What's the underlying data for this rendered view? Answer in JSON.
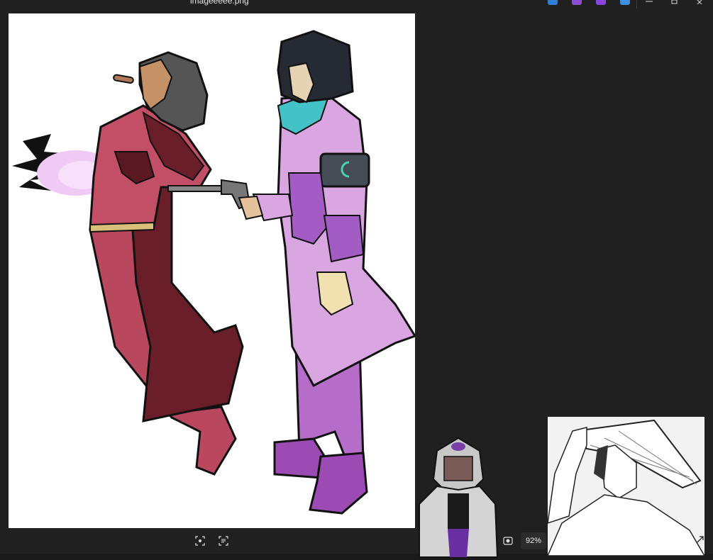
{
  "window": {
    "title": "imageeeee.png",
    "controls": {
      "minimize_icon": "minimize-icon",
      "maximize_icon": "restore-icon",
      "close_icon": "close-icon"
    }
  },
  "taskbar": {
    "apps": [
      {
        "name": "app-1-icon",
        "color": "#2f7fd6"
      },
      {
        "name": "app-2-icon",
        "color": "#8a4fd0"
      },
      {
        "name": "app-3-icon",
        "color": "#8b44e0"
      },
      {
        "name": "app-4-icon",
        "color": "#3d8fe0"
      }
    ]
  },
  "toolbar": {
    "fit_icon": "fit-to-screen-icon",
    "crop_icon": "text-select-icon",
    "actual_size_icon": "actual-size-icon",
    "zoom_label": "92%",
    "expand_icon": "expand-icon"
  },
  "colors": {
    "background": "#202020",
    "canvas": "#ffffff"
  }
}
